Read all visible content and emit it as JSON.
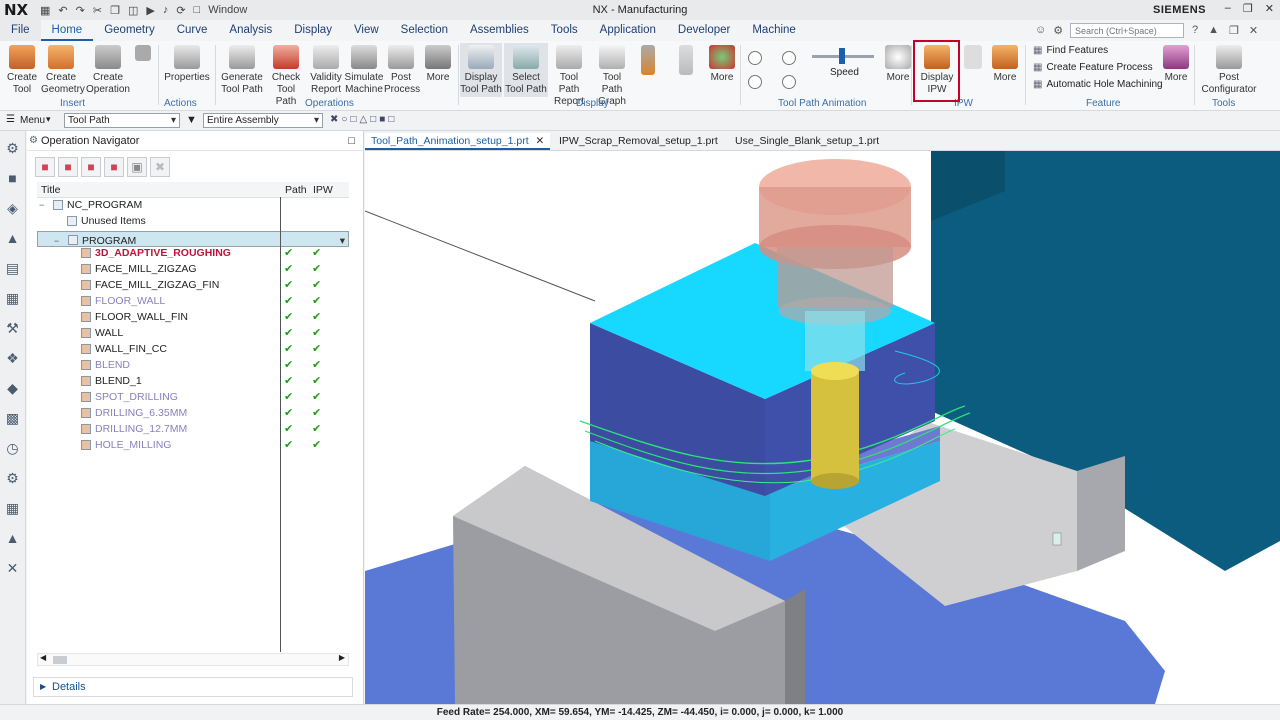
{
  "app": {
    "logo": "NX",
    "title": "NX - Manufacturing",
    "brand": "SIEMENS",
    "window_menu": "Window",
    "search_placeholder": "Search (Ctrl+Space)"
  },
  "menubar": {
    "tabs": [
      "File",
      "Home",
      "Geometry",
      "Curve",
      "Analysis",
      "Display",
      "View",
      "Selection",
      "Assemblies",
      "Tools",
      "Application",
      "Developer",
      "Machine"
    ],
    "active": "Home"
  },
  "ribbon": {
    "insert": {
      "label": "Insert",
      "create_tool": "Create Tool",
      "create_geometry": "Create Geometry",
      "create_operation": "Create Operation"
    },
    "actions": {
      "label": "Actions",
      "properties": "Properties"
    },
    "operations": {
      "label": "Operations",
      "generate": "Generate Tool Path",
      "check": "Check Tool Path",
      "validity": "Validity Report",
      "simulate": "Simulate Machine",
      "post": "Post Process",
      "more": "More"
    },
    "display": {
      "label": "Display",
      "display_tp": "Display Tool Path",
      "select_tp": "Select Tool Path",
      "tp_report": "Tool Path Report",
      "tp_graph": "Tool Path Graph",
      "more": "More"
    },
    "animation": {
      "label": "Tool Path Animation",
      "speed": "Speed",
      "more": "More"
    },
    "ipw": {
      "label": "IPW",
      "display_ipw": "Display IPW",
      "more": "More"
    },
    "feature": {
      "label": "Feature",
      "find": "Find Features",
      "process": "Create Feature Process",
      "hole": "Automatic Hole Machining",
      "more": "More"
    },
    "tools": {
      "label": "Tools",
      "post_config": "Post Configurator"
    }
  },
  "toolbar2": {
    "menu": "Menu",
    "filter": "Tool Path",
    "scope": "Entire Assembly"
  },
  "navigator": {
    "title": "Operation Navigator",
    "columns": {
      "title": "Title",
      "path": "Path",
      "ipw": "IPW"
    },
    "rows": [
      {
        "name": "NC_PROGRAM",
        "indent": 0,
        "style": "normal",
        "path": "",
        "ipw": ""
      },
      {
        "name": "Unused Items",
        "indent": 1,
        "style": "normal",
        "path": "",
        "ipw": ""
      },
      {
        "name": "PROGRAM",
        "indent": 1,
        "style": "normal",
        "path": "",
        "ipw": "",
        "selected": true
      },
      {
        "name": "3D_ADAPTIVE_ROUGHING",
        "indent": 2,
        "style": "red",
        "path": "✔",
        "ipw": "✔"
      },
      {
        "name": "FACE_MILL_ZIGZAG",
        "indent": 2,
        "style": "normal",
        "path": "✔",
        "ipw": "✔"
      },
      {
        "name": "FACE_MILL_ZIGZAG_FIN",
        "indent": 2,
        "style": "normal",
        "path": "✔",
        "ipw": "✔"
      },
      {
        "name": "FLOOR_WALL",
        "indent": 2,
        "style": "gray",
        "path": "✔",
        "ipw": "✔"
      },
      {
        "name": "FLOOR_WALL_FIN",
        "indent": 2,
        "style": "normal",
        "path": "✔",
        "ipw": "✔"
      },
      {
        "name": "WALL",
        "indent": 2,
        "style": "normal",
        "path": "✔",
        "ipw": "✔"
      },
      {
        "name": "WALL_FIN_CC",
        "indent": 2,
        "style": "normal",
        "path": "✔",
        "ipw": "✔"
      },
      {
        "name": "BLEND",
        "indent": 2,
        "style": "gray",
        "path": "✔",
        "ipw": "✔"
      },
      {
        "name": "BLEND_1",
        "indent": 2,
        "style": "normal",
        "path": "✔",
        "ipw": "✔"
      },
      {
        "name": "SPOT_DRILLING",
        "indent": 2,
        "style": "gray",
        "path": "✔",
        "ipw": "✔"
      },
      {
        "name": "DRILLING_6.35MM",
        "indent": 2,
        "style": "gray",
        "path": "✔",
        "ipw": "✔"
      },
      {
        "name": "DRILLING_12.7MM",
        "indent": 2,
        "style": "gray",
        "path": "✔",
        "ipw": "✔"
      },
      {
        "name": "HOLE_MILLING",
        "indent": 2,
        "style": "gray",
        "path": "✔",
        "ipw": "✔"
      }
    ],
    "details": "Details"
  },
  "doc_tabs": [
    "Tool_Path_Animation_setup_1.prt",
    "IPW_Scrap_Removal_setup_1.prt",
    "Use_Single_Blank_setup_1.prt"
  ],
  "status": "Feed Rate= 254.000, XM= 59.654, YM= -14.425, ZM= -44.450, i= 0.000, j= 0.000, k= 1.000"
}
